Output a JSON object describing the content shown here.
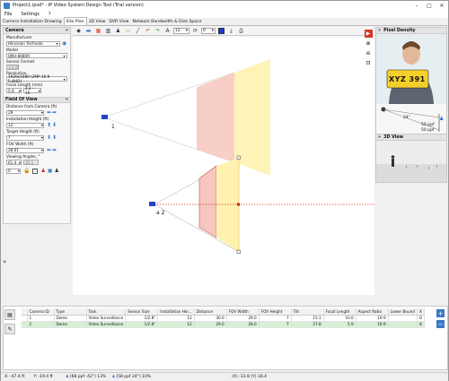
{
  "window": {
    "title": "Project1.ipsd* - IP Video System Design Tool (Trial version)"
  },
  "menu": [
    "File",
    "Settings",
    "?"
  ],
  "tabs": [
    "Camera Installation Drawing",
    "Site Plan",
    "3D View",
    "DVR View",
    "Network Bandwidth & Disk Space"
  ],
  "active_tab": 1,
  "left": {
    "camera_header": "Camera",
    "manufacturer_label": "Manufacturer",
    "manufacturer_value": "Hikvision Technolo",
    "model_label": "Model",
    "model_value": "QNV-8080R",
    "sensor_label": "Sensor Format",
    "sensor_value": "1/2.8\"",
    "resolution_label": "Resolution",
    "resolution_value": "1920x1080 (2MP 16:9 FullHD)",
    "focal_label": "Focal Length (mm)",
    "focal_value": "5.9",
    "focal_range": "3.2 - 10",
    "fov_header": "Field Of View",
    "distance_label": "Distance from Camera (ft)",
    "distance_value": "29",
    "install_label": "Installation Height (ft)",
    "install_value": "12",
    "target_label": "Target Height (ft)",
    "target_value": "7",
    "fovwidth_label": "FOV Width (ft)",
    "fovwidth_value": "28.01",
    "angles_label": "Viewing Angles, °",
    "angle_h": "61.4",
    "angle_v": "35.1",
    "bottom_value": "0"
  },
  "toolbar": {
    "size_value": "12",
    "rotate_value": "0"
  },
  "canvas": {
    "camera1_label": "1",
    "camera2_label": "a 2"
  },
  "pixel_density": {
    "header": "Pixel Density",
    "plate_text": "XYZ 391",
    "angle_text": "24°",
    "ppf_top": "50 ppf",
    "ppf_bottom": "50 ppf",
    "view3d_header": "3D View"
  },
  "table": {
    "columns": [
      "",
      "Camera ID",
      "Type",
      "Task",
      "Sensor Size",
      "Installation Hei...",
      "Distance",
      "FOV Width",
      "FOV Height",
      "Tilt",
      "Focal Length",
      "Aspect Ratio",
      "Lower Bound",
      "X"
    ],
    "rows": [
      [
        "",
        "1",
        "Dome",
        "Video Surveillance",
        "1/2.8\"",
        "12",
        "30.0",
        "29.0",
        "7",
        "15.1",
        "10.0",
        "16:9",
        "",
        "8"
      ],
      [
        "",
        "2",
        "Dome",
        "Video Surveillance",
        "1/2.8\"",
        "12",
        "29.0",
        "28.0",
        "7",
        "27.8",
        "5.9",
        "16:9",
        "",
        "8"
      ]
    ],
    "selected_row": 1
  },
  "status": {
    "x": "X: -47.4 ft",
    "y": "Y: -19.4 ft",
    "ppf1": "(68 ppf -42°) 13%",
    "ppf2": "(58 ppf 24°) 10%",
    "coords": "(X) -13.8 (Y) 18.4"
  },
  "colors": {
    "accent": "#3a78c8",
    "fov_yellow": "#fff2b0",
    "fov_red": "#f6c7bd",
    "selected_row": "#d6f0d6"
  }
}
